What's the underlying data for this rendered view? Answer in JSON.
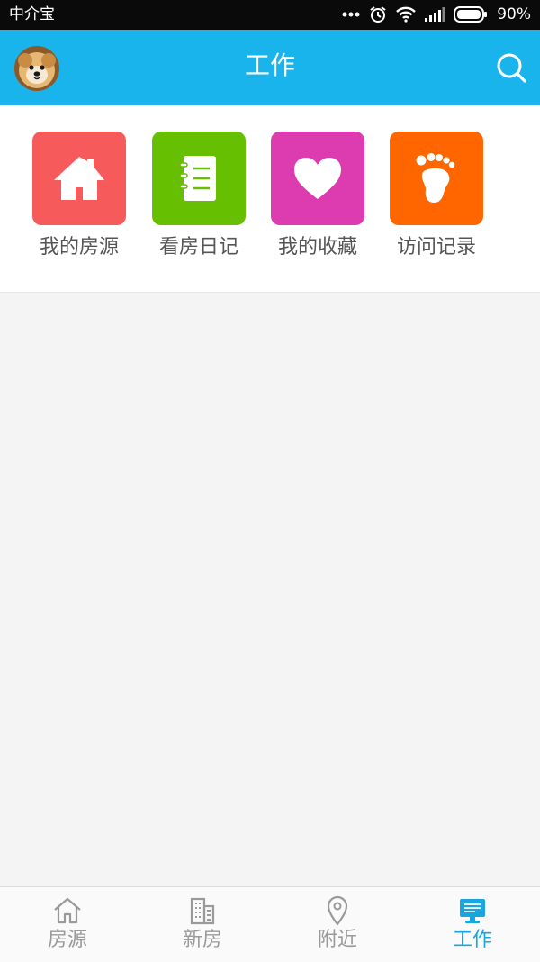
{
  "status_bar": {
    "carrier": "中介宝",
    "battery": "90%"
  },
  "app_bar": {
    "title": "工作",
    "avatar_alt": "avatar",
    "search_icon": "search-icon"
  },
  "shortcuts": [
    {
      "label": "我的房源",
      "icon": "house-icon",
      "color": "#f75a5a"
    },
    {
      "label": "看房日记",
      "icon": "notebook-icon",
      "color": "#66bf00"
    },
    {
      "label": "我的收藏",
      "icon": "heart-icon",
      "color": "#dd3bb0"
    },
    {
      "label": "访问记录",
      "icon": "footprint-icon",
      "color": "#ff6600"
    }
  ],
  "bottom_nav": {
    "items": [
      {
        "label": "房源",
        "icon": "house-outline-icon",
        "active": false
      },
      {
        "label": "新房",
        "icon": "building-icon",
        "active": false
      },
      {
        "label": "附近",
        "icon": "location-pin-icon",
        "active": false
      },
      {
        "label": "工作",
        "icon": "monitor-icon",
        "active": true
      }
    ],
    "active_color": "#19a6de",
    "inactive_color": "#9a9a9a"
  },
  "colors": {
    "app_bar": "#19b4ec",
    "background": "#f4f4f4"
  }
}
